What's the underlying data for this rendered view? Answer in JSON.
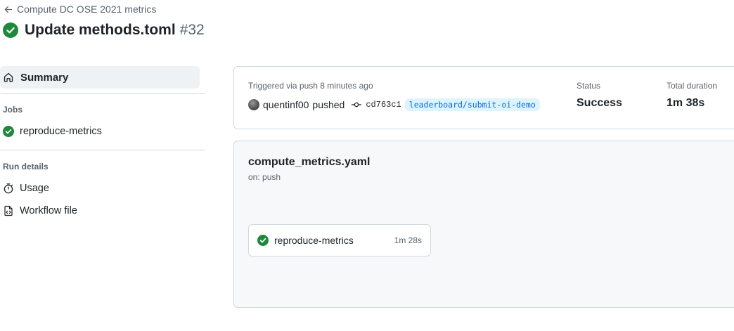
{
  "header": {
    "back_label": "Compute DC OSE 2021 metrics",
    "run_title": "Update methods.toml",
    "run_number": "#32"
  },
  "sidebar": {
    "summary_label": "Summary",
    "jobs_heading": "Jobs",
    "jobs": [
      {
        "label": "reproduce-metrics",
        "status": "success"
      }
    ],
    "run_details_heading": "Run details",
    "run_details": [
      {
        "label": "Usage",
        "icon": "stopwatch-icon"
      },
      {
        "label": "Workflow file",
        "icon": "file-code-icon"
      }
    ]
  },
  "trigger": {
    "triggered_text": "Triggered via push 8 minutes ago",
    "user": "quentinf00",
    "action": "pushed",
    "commit_sha": "cd763c1",
    "branch": "leaderboard/submit-oi-demo",
    "status_label": "Status",
    "status_value": "Success",
    "duration_label": "Total duration",
    "duration_value": "1m 38s"
  },
  "workflow": {
    "file_name": "compute_metrics.yaml",
    "trigger_event": "on: push",
    "job": {
      "name": "reproduce-metrics",
      "duration": "1m 28s",
      "status": "success"
    }
  },
  "colors": {
    "success_green": "#1f883d",
    "link_blue": "#0969da",
    "branch_bg": "#ddf4ff",
    "muted": "#59636e"
  }
}
